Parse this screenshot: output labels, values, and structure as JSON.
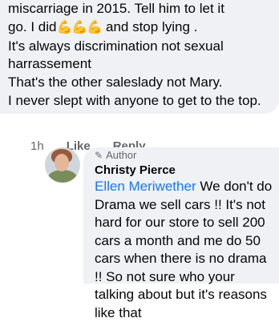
{
  "comment1": {
    "lines": [
      "miscarriage in 2015. Tell him to let it",
      "go. I did",
      "and stop lying .",
      "It's always discrimination not sexual harrassement",
      "That's the other saleslady not Mary.",
      "I never slept with anyone to get to the top."
    ],
    "emoji": "💪💪💪",
    "time": "1h",
    "like_label": "Like",
    "reply_label": "Reply"
  },
  "comment2": {
    "author_badge": "Author",
    "name": "Christy Pierce",
    "mention": "Ellen Meriwether",
    "text": " We don't do Drama we sell cars !! It's not hard for our store to sell 200 cars a month and me do 50 cars when there is no drama !! So not sure who your talking about but it's reasons like that"
  }
}
